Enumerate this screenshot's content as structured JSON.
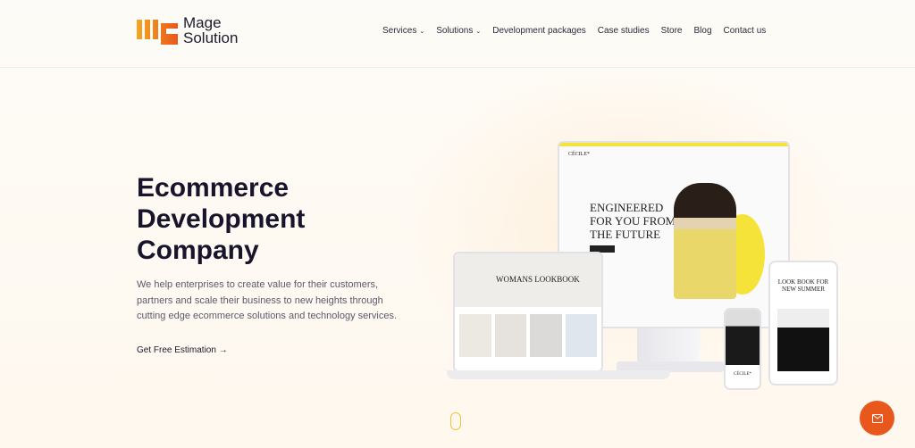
{
  "brand": {
    "name_line1": "Mage",
    "name_line2": "Solution",
    "accent": "#f08a1c"
  },
  "nav": [
    {
      "label": "Services",
      "dropdown": true
    },
    {
      "label": "Solutions",
      "dropdown": true
    },
    {
      "label": "Development packages"
    },
    {
      "label": "Case studies"
    },
    {
      "label": "Store"
    },
    {
      "label": "Blog"
    },
    {
      "label": "Contact us"
    }
  ],
  "hero": {
    "title": "Ecommerce Development Company",
    "description": "We help enterprises to create value for their customers, partners and scale their business to new heights through cutting edge ecommerce solutions and technology services.",
    "cta": "Get Free Estimation"
  },
  "mockup": {
    "monitor_brand": "CÉCILE*",
    "monitor_headline": "ENGINEERED FOR YOU FROM THE FUTURE",
    "laptop_headline": "WOMANS LOOKBOOK",
    "tablet_headline": "LOOK BOOK FOR NEW SUMMER",
    "phone_brand": "CÉCILE*"
  },
  "fab": {
    "icon": "mail-icon",
    "color": "#e8581c"
  }
}
